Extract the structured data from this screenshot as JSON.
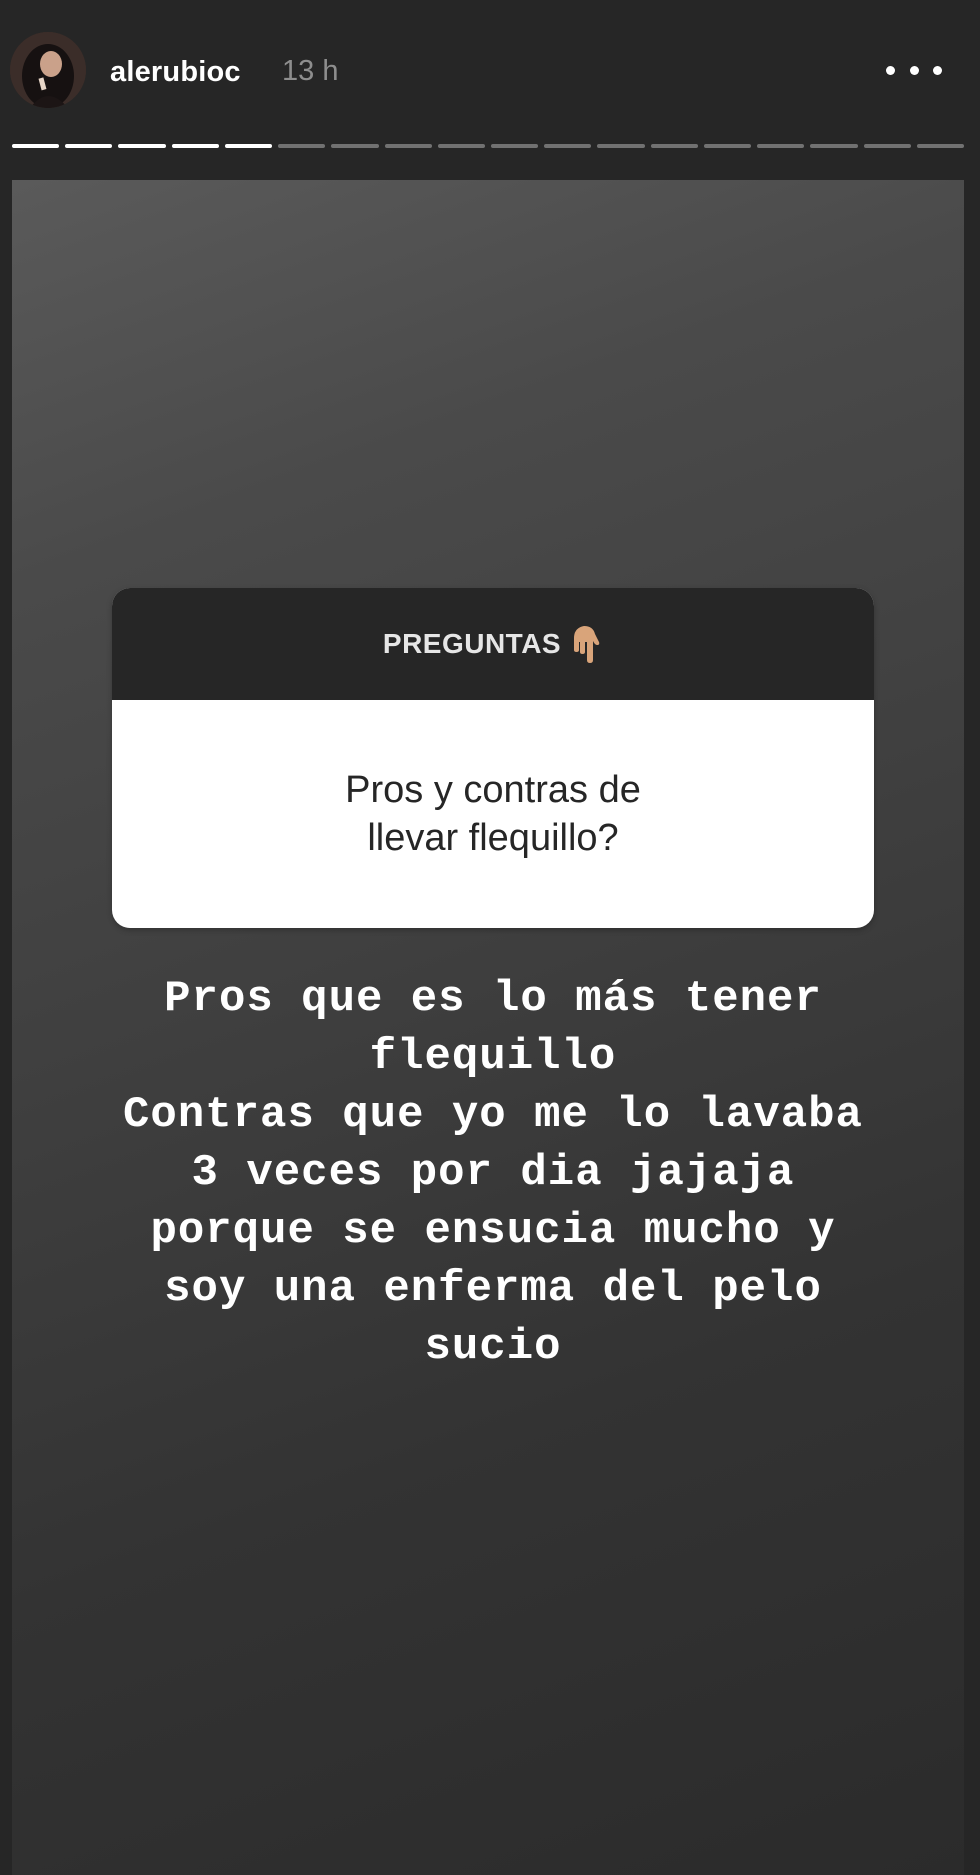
{
  "header": {
    "username": "alerubioc",
    "time": "13 h",
    "progress_total_segments": 18,
    "progress_completed_segments": 5
  },
  "question_sticker": {
    "title": "PREGUNTAS",
    "title_icon": "hand-pointing-down-icon",
    "question": "Pros y contras de llevar flequillo?"
  },
  "answer": {
    "lines": [
      "Pros que es lo más tener",
      "flequillo",
      "Contras que yo me lo lavaba",
      "3 veces por dia jajaja",
      "porque se ensucia mucho y",
      "soy una enferma del pelo",
      "sucio"
    ]
  },
  "colors": {
    "background": "#262626",
    "sticker_header": "#262626",
    "sticker_body": "#ffffff",
    "text_light": "#ffffff",
    "text_muted": "#8e8e8e"
  }
}
